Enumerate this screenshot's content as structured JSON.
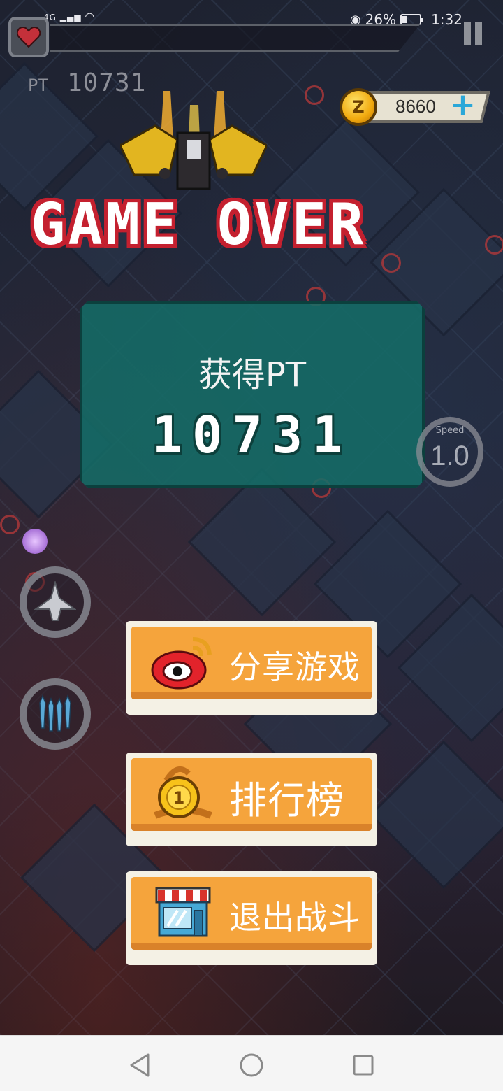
{
  "status_bar": {
    "network": "4G",
    "battery_percent": "26%",
    "time": "1:32"
  },
  "hud": {
    "pt_label": "PT",
    "pt_value": "10731",
    "coins": "8660",
    "add_coins_symbol": "+",
    "coin_symbol": "Z"
  },
  "game_over": {
    "title": "GAME OVER",
    "earned_label": "获得PT",
    "earned_value": "10731"
  },
  "speed": {
    "label": "Speed",
    "value": "1.0"
  },
  "menu": {
    "share_label": "分享游戏",
    "ranking_label": "排行榜",
    "exit_label": "退出战斗",
    "ranking_medal_number": "1"
  },
  "icons": {
    "health": "heart-icon",
    "pause": "pause-icon",
    "coin": "coin-icon",
    "add": "plus-icon",
    "share": "weibo-icon",
    "ranking": "medal-icon",
    "exit": "shop-icon",
    "skill_1": "fighter-icon",
    "skill_2": "missile-barrage-icon",
    "nav_back": "back-triangle-icon",
    "nav_home": "home-circle-icon",
    "nav_recent": "recent-square-icon"
  },
  "colors": {
    "title_outline": "#c4202f",
    "panel": "#146e68",
    "button": "#f5a43c",
    "coin_plus": "#2ba7d8"
  }
}
